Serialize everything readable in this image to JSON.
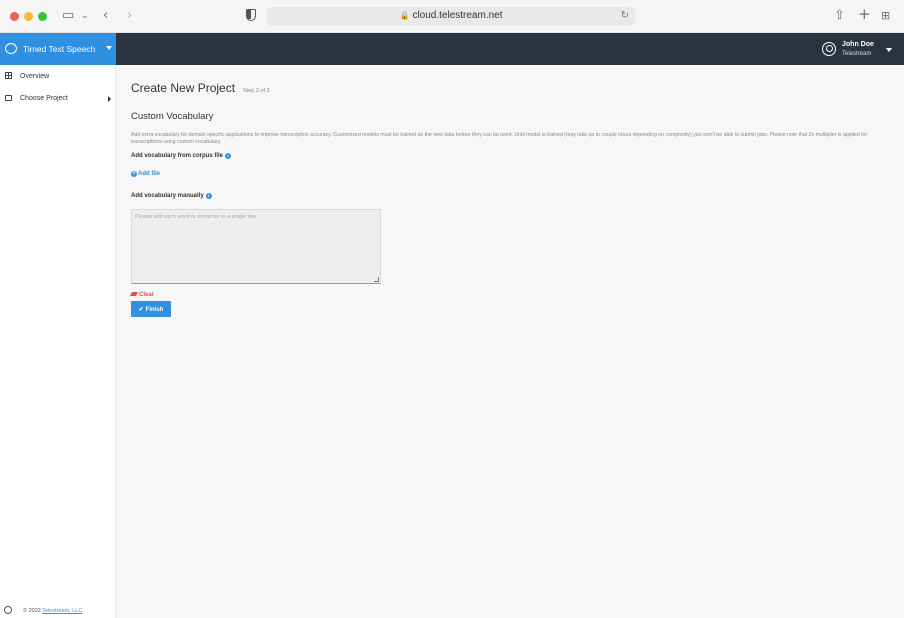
{
  "browser": {
    "url": "cloud.telestream.net",
    "icons": [
      "sidebar-icon",
      "chevron-down-icon",
      "back-icon",
      "forward-icon",
      "shield-icon",
      "lock-icon",
      "reload-icon",
      "share-icon",
      "plus-icon",
      "tabs-grid-icon"
    ]
  },
  "header": {
    "app_name": "Timed Text Speech",
    "user_name": "John Doe",
    "user_org": "Telestream"
  },
  "sidebar": {
    "items": [
      {
        "label": "Overview",
        "icon": "grid-icon"
      },
      {
        "label": "Choose Project",
        "icon": "folder-icon"
      }
    ],
    "footer_prefix": "© 2022",
    "footer_link": "Telestream, LLC"
  },
  "main": {
    "title": "Create New Project",
    "step": "Step 2 of 2",
    "section_title": "Custom Vocabulary",
    "description": "Add extra vocabulary for domain specific applications to improve transcription accuracy. Customized models must be trained on the new data before they can be used. Until model is trained (may take up to couple hours depending on complexity) you won't be able to submit jobs. Please note that 2x multiplier is applied for transcriptions using custom vocabulary.",
    "corpus_label": "Add vocabulary from corpus file",
    "add_file": "Add file",
    "manual_label": "Add vocabulary manually",
    "manual_placeholder": "Please add each word or sentence in a single line",
    "clear": "Clear",
    "finish": "Finish"
  },
  "colors": {
    "accent": "#2f8fe0",
    "header_bg": "#2c3340",
    "danger": "#d9534f"
  }
}
